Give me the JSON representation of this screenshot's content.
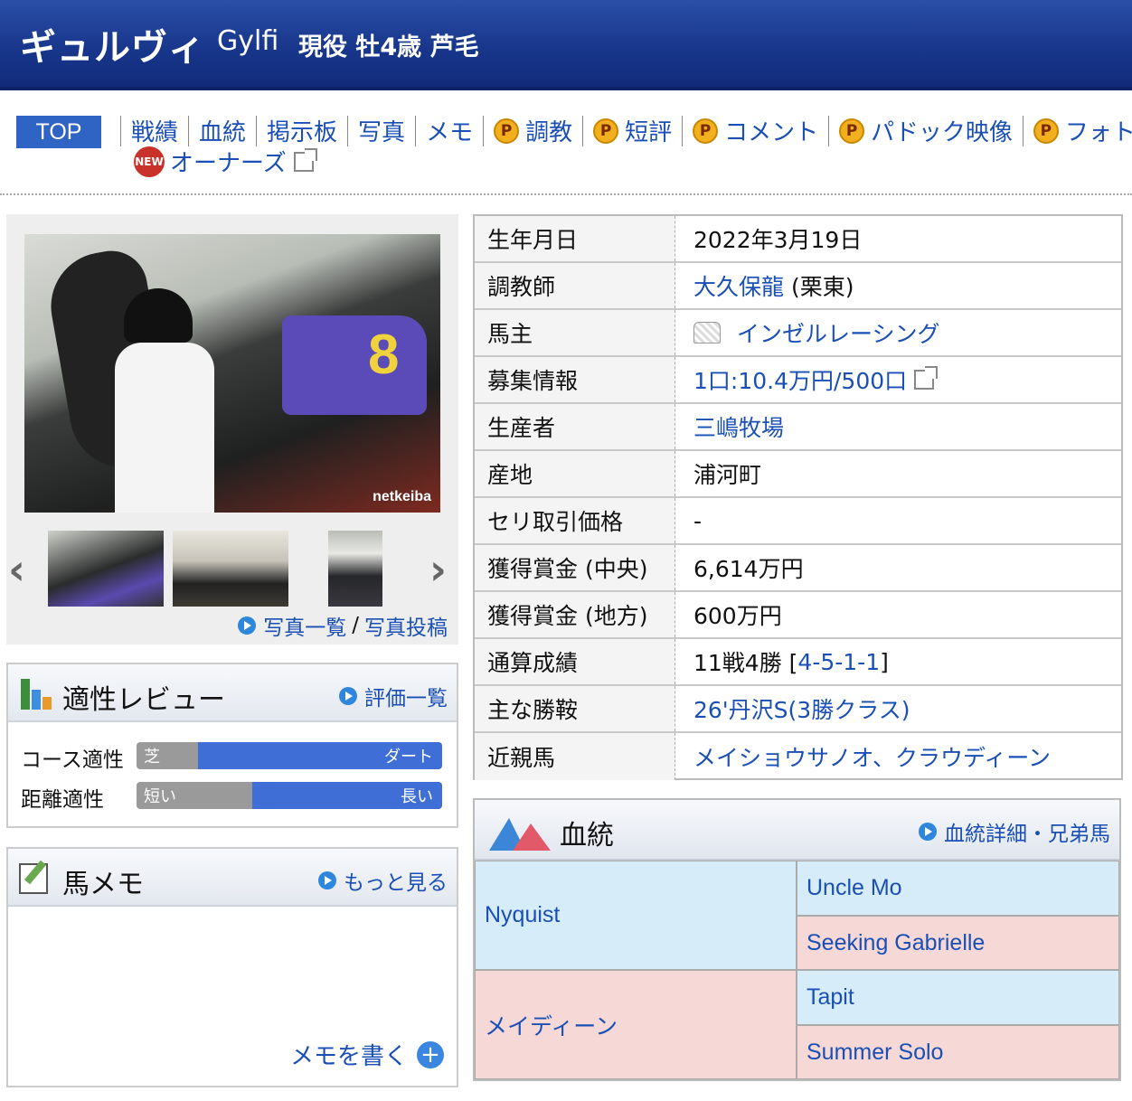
{
  "header": {
    "name_ja": "ギュルヴィ",
    "name_en": "Gylfi",
    "status": "現役 牡4歳 芦毛"
  },
  "nav": {
    "top": "TOP",
    "items": [
      "戦績",
      "血統",
      "掲示板",
      "写真",
      "メモ"
    ],
    "premium_items": [
      "調教",
      "短評",
      "コメント",
      "パドック映像",
      "フォトパ"
    ],
    "new_badge": "NEW",
    "owner": "オーナーズ"
  },
  "photo": {
    "watermark": "netkeiba",
    "saddle_number": "8",
    "list_link": "写真一覧",
    "separator": "/",
    "post_link": "写真投稿"
  },
  "review": {
    "title": "適性レビュー",
    "more": "評価一覧",
    "course_label": "コース適性",
    "course_left": "芝",
    "course_right": "ダート",
    "course_ratio": 0.2,
    "distance_label": "距離適性",
    "distance_left": "短い",
    "distance_right": "長い",
    "distance_ratio": 0.38
  },
  "memo": {
    "title": "馬メモ",
    "more": "もっと見る",
    "write": "メモを書く"
  },
  "info": [
    {
      "key": "生年月日",
      "value": "2022年3月19日"
    },
    {
      "key": "調教師",
      "link": "大久保龍",
      "suffix": " (栗東)"
    },
    {
      "key": "馬主",
      "link": "インゼルレーシング"
    },
    {
      "key": "募集情報",
      "link": "1口:10.4万円/500口"
    },
    {
      "key": "生産者",
      "link": "三嶋牧場"
    },
    {
      "key": "産地",
      "value": "浦河町"
    },
    {
      "key": "セリ取引価格",
      "value": "-"
    },
    {
      "key": "獲得賞金 (中央)",
      "value": "6,614万円"
    },
    {
      "key": "獲得賞金 (地方)",
      "value": "600万円"
    },
    {
      "key": "通算成績",
      "value": "11戦4勝 [",
      "link": "4-5-1-1",
      "suffix": "]"
    },
    {
      "key": "主な勝鞍",
      "link": "26'丹沢S(3勝クラス)"
    },
    {
      "key": "近親馬",
      "link": "メイショウサノオ、クラウディーン"
    }
  ],
  "pedigree": {
    "title": "血統",
    "more": "血統詳細・兄弟馬",
    "sire": "Nyquist",
    "dam": "メイディーン",
    "sire_sire": "Uncle Mo",
    "sire_dam": "Seeking Gabrielle",
    "dam_sire": "Tapit",
    "dam_dam": "Summer Solo"
  },
  "colors": {
    "header_bg": "#17358a",
    "link": "#1a4fb5",
    "male_cell": "#d6ecf9",
    "female_cell": "#f6d9d6"
  }
}
